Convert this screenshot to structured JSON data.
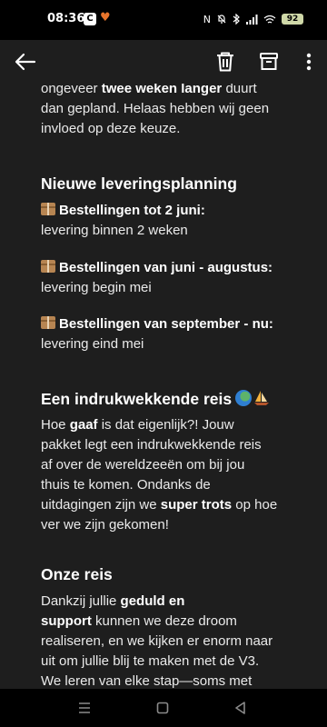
{
  "status_bar": {
    "time": "08:36",
    "app_badge": "C",
    "battery": "92"
  },
  "icons": {
    "back": "arrow-left-icon",
    "delete": "trash-icon",
    "archive": "archive-icon",
    "more": "more-vert-icon",
    "package": "package-box-icon",
    "globe": "globe-icon",
    "sailboat": "sailboat-icon"
  },
  "colors": {
    "background": "#1e1e1e",
    "text": "#eaeaea",
    "heading": "#ffffff",
    "status_bar": "#000000",
    "battery": "#cfd8a8",
    "heart": "#e8742b"
  },
  "email": {
    "intro": {
      "l1_bold": "twee weken langer",
      "l1_pre": "ongeveer ",
      "l1_post": " duurt",
      "l2": "dan gepland. Helaas hebben wij geen",
      "l3": "invloed op deze keuze."
    },
    "planning": {
      "heading": "Nieuwe leveringsplanning",
      "items": [
        {
          "title": "Bestellingen tot 2 juni:",
          "detail": "levering binnen 2 weken"
        },
        {
          "title": "Bestellingen van juni - augustus:",
          "detail": "levering begin mei"
        },
        {
          "title": "Bestellingen van september - nu:",
          "detail": "levering eind mei"
        }
      ]
    },
    "journey": {
      "heading": "Een indrukwekkende reis",
      "l1_pre": "Hoe ",
      "l1_bold": "gaaf",
      "l1_post": " is dat eigenlijk?! Jouw",
      "l2": "pakket legt een indrukwekkende reis",
      "l3": "af over de wereldzeeën om bij jou",
      "l4": "thuis te komen. Ondanks de",
      "l5_pre": "uitdagingen zijn we ",
      "l5_bold": "super trots",
      "l5_post": " op hoe",
      "l6": "ver we zijn gekomen!"
    },
    "our_journey": {
      "heading": "Onze reis",
      "l1_pre": "Dankzij jullie ",
      "l1_bold": "geduld en",
      "l2_bold": "support",
      "l2_post": " kunnen we deze droom",
      "l3": "realiseren, en we kijken er enorm naar",
      "l4": "uit om jullie blij te maken met de V3.",
      "l5": "We leren van elke stap—soms met"
    }
  },
  "nav": {
    "menu": "recent-apps-icon",
    "home": "home-icon",
    "back": "back-triangle-icon"
  }
}
